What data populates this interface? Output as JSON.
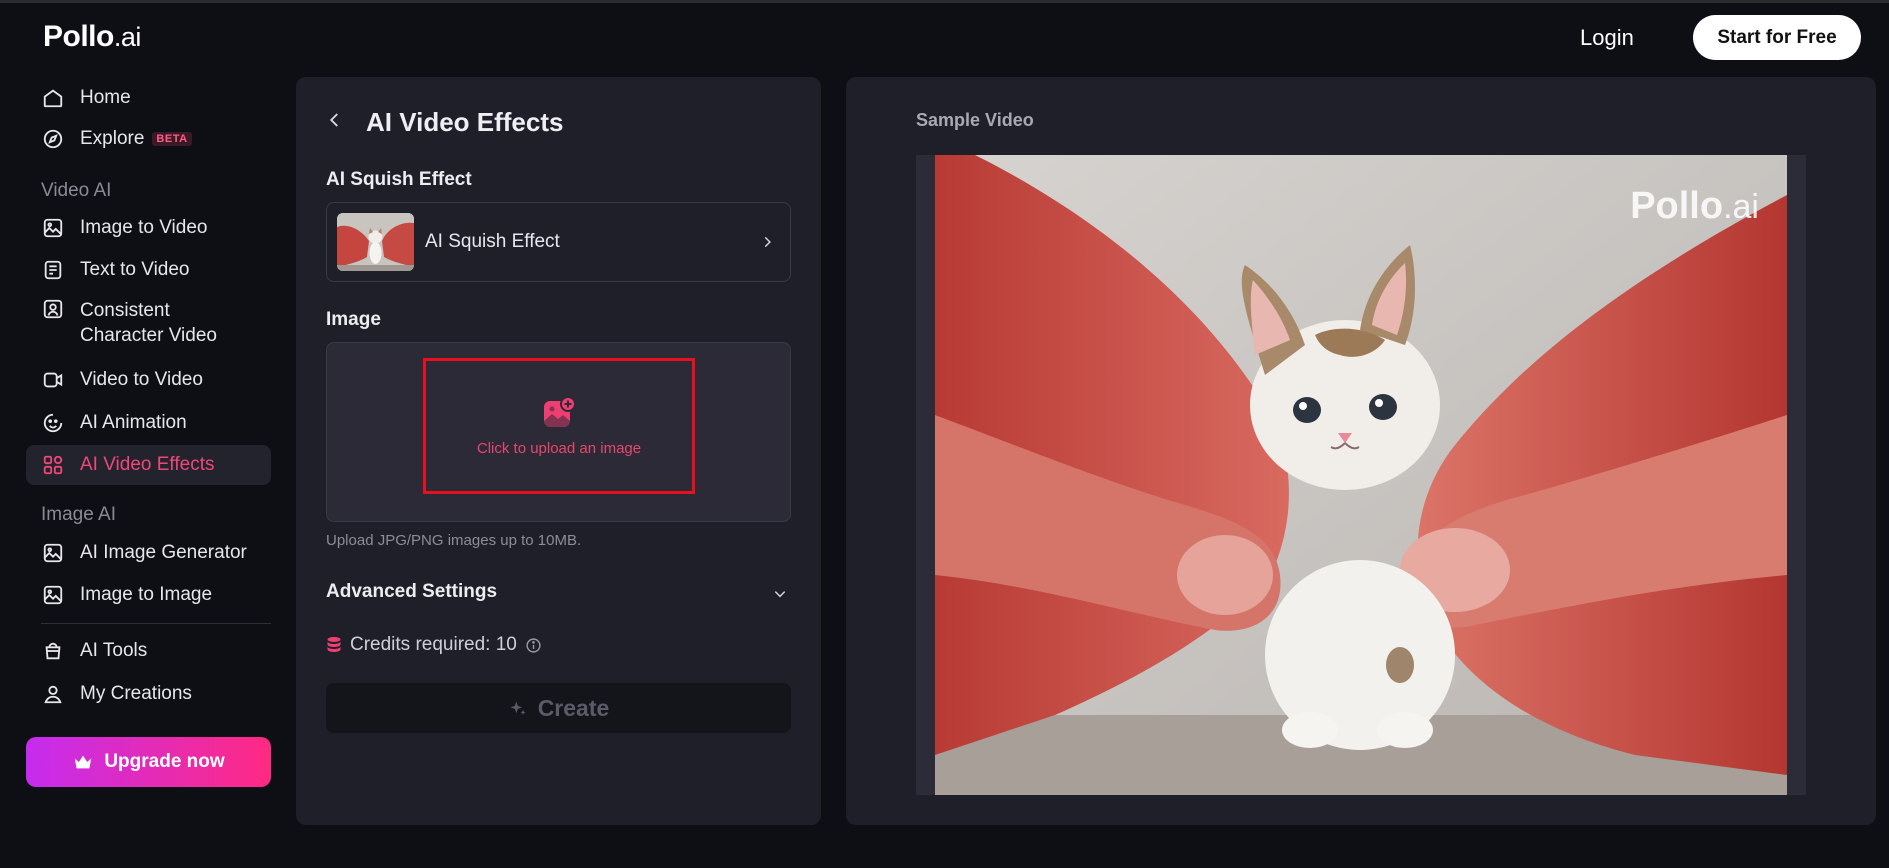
{
  "header": {
    "logo_main": "Pollo",
    "logo_suffix": ".ai",
    "login_label": "Login",
    "start_label": "Start for Free"
  },
  "sidebar": {
    "home": "Home",
    "explore": "Explore",
    "beta_badge": "BETA",
    "video_section": "Video AI",
    "image_to_video": "Image to Video",
    "text_to_video": "Text to Video",
    "consistent_character_video": "Consistent Character Video",
    "video_to_video": "Video to Video",
    "ai_animation": "AI Animation",
    "ai_video_effects": "AI Video Effects",
    "image_section": "Image AI",
    "ai_image_generator": "AI Image Generator",
    "image_to_image": "Image to Image",
    "ai_tools": "AI Tools",
    "my_creations": "My Creations",
    "upgrade_label": "Upgrade now"
  },
  "panel": {
    "title": "AI Video Effects",
    "effect_label": "AI Squish Effect",
    "selected_effect": "AI Squish Effect",
    "image_label": "Image",
    "upload_text": "Click to upload an image",
    "upload_hint": "Upload JPG/PNG images up to 10MB.",
    "advanced_label": "Advanced Settings",
    "credits_label": "Credits required: 10",
    "create_label": "Create"
  },
  "preview": {
    "sample_label": "Sample Video",
    "watermark_main": "Pollo",
    "watermark_suffix": ".ai"
  },
  "colors": {
    "accent": "#f0467a",
    "upload_highlight": "#e8101e",
    "upgrade_gradient_start": "#c52cf0",
    "upgrade_gradient_end": "#ff2a82"
  }
}
